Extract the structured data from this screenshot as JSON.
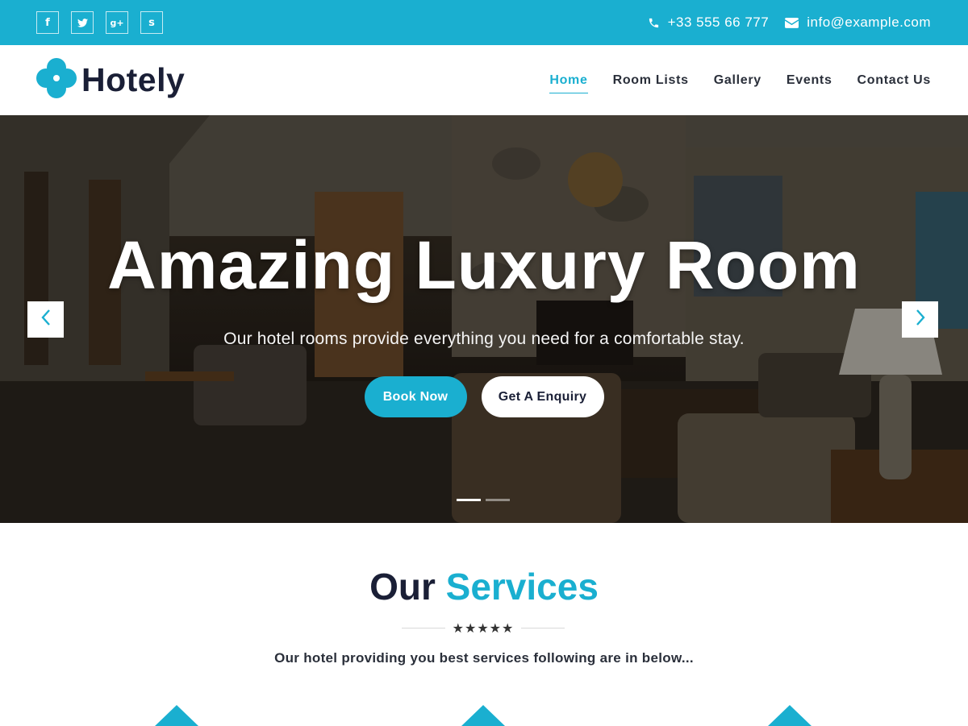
{
  "topbar": {
    "socials": [
      {
        "icon": "facebook-icon",
        "glyph": "f"
      },
      {
        "icon": "twitter-icon",
        "glyph": "t"
      },
      {
        "icon": "google-plus-icon",
        "glyph": "g+"
      },
      {
        "icon": "stumbleupon-icon",
        "glyph": "s"
      }
    ],
    "phone": "+33 555 66 777",
    "email": "info@example.com"
  },
  "header": {
    "logo_text": "Hotely",
    "nav": [
      {
        "label": "Home",
        "active": true
      },
      {
        "label": "Room Lists",
        "active": false
      },
      {
        "label": "Gallery",
        "active": false
      },
      {
        "label": "Events",
        "active": false
      },
      {
        "label": "Contact Us",
        "active": false
      }
    ]
  },
  "hero": {
    "title": "Amazing Luxury Room",
    "subtitle": "Our hotel rooms provide everything you need for a comfortable stay.",
    "primary_button": "Book Now",
    "secondary_button": "Get A Enquiry",
    "slides_count": 2,
    "active_slide": 1
  },
  "services": {
    "title_part1": "Our",
    "title_part2": "Services",
    "stars": "★★★★★",
    "subtitle": "Our hotel providing you best services following are in below..."
  },
  "colors": {
    "accent": "#1aafd0",
    "dark": "#1a1f36"
  }
}
